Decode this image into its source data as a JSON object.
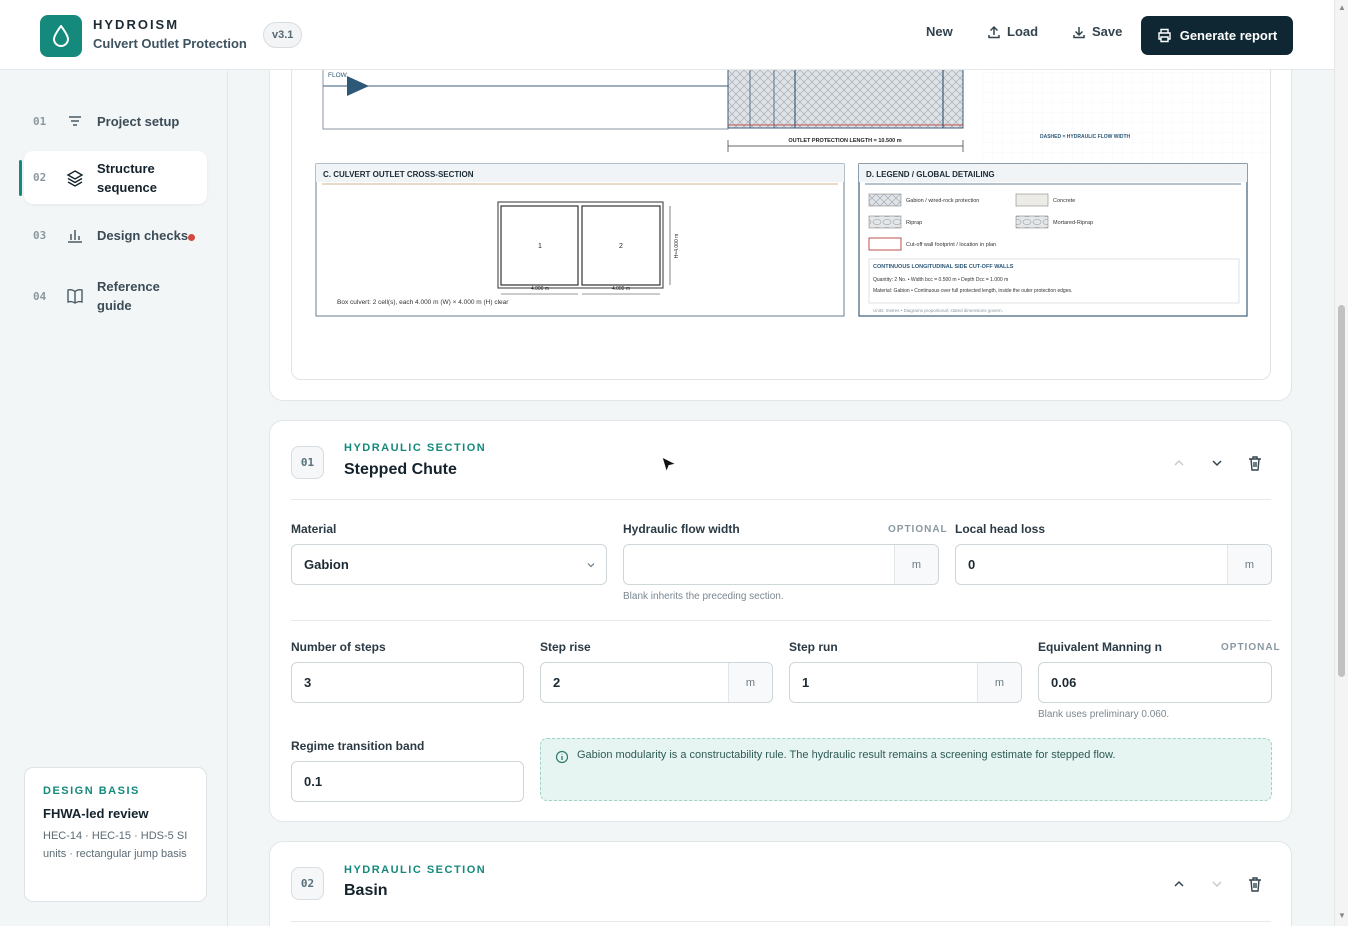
{
  "header": {
    "brand": "HYDROISM",
    "subtitle": "Culvert Outlet Protection",
    "version": "v3.1",
    "new_label": "New",
    "load_label": "Load",
    "save_label": "Save",
    "generate_label": "Generate report"
  },
  "sidebar": {
    "items": [
      {
        "num": "01",
        "label": "Project setup",
        "icon": "filter-icon"
      },
      {
        "num": "02",
        "label": "Structure sequence",
        "icon": "layers-icon"
      },
      {
        "num": "03",
        "label": "Design checks",
        "icon": "chart-icon"
      },
      {
        "num": "04",
        "label": "Reference guide",
        "icon": "book-icon"
      }
    ],
    "basis": {
      "kicker": "DESIGN BASIS",
      "title": "FHWA-led review",
      "desc": "HEC-14 · HEC-15 · HDS-5 SI units · rectangular jump basis"
    }
  },
  "drawing": {
    "flow_label": "FLOW",
    "length_label": "OUTLET PROTECTION LENGTH = 10.500 m",
    "dashed_note": "DASHED = HYDRAULIC FLOW WIDTH",
    "section_c": {
      "title": "C. CULVERT OUTLET CROSS-SECTION",
      "cell1": "1",
      "cell2": "2",
      "dim1": "4.000 m",
      "dim2": "4.000 m",
      "height": "H=4.000 m",
      "caption": "Box culvert: 2 cell(s), each 4.000 m (W) × 4.000 m (H) clear"
    },
    "section_d": {
      "title": "D. LEGEND / GLOBAL DETAILING",
      "legend": [
        "Gabion / wired-rock protection",
        "Concrete",
        "Riprap",
        "Mortared-Riprap",
        "Cut-off wall footprint / location in plan"
      ],
      "box_title": "CONTINUOUS LONGITUDINAL SIDE CUT-OFF WALLS",
      "box_line1": "Quantity: 2 No. • Width bcc = 0.500 m • Depth Dcc = 1.000 m",
      "box_line2": "Material: Gabion • Continuous over full protected length, inside the outer protection edges.",
      "units_note": "Units: metres • Diagrams proportional; stated dimensions govern."
    }
  },
  "section1": {
    "num": "01",
    "kicker": "HYDRAULIC SECTION",
    "title": "Stepped Chute",
    "material_label": "Material",
    "material_value": "Gabion",
    "flow_width_label": "Hydraulic flow width",
    "optional": "OPTIONAL",
    "flow_width_value": "",
    "flow_width_unit": "m",
    "flow_width_hint": "Blank inherits the preceding section.",
    "head_loss_label": "Local head loss",
    "head_loss_value": "0",
    "head_loss_unit": "m",
    "steps_label": "Number of steps",
    "steps_value": "3",
    "rise_label": "Step rise",
    "rise_value": "2",
    "rise_unit": "m",
    "run_label": "Step run",
    "run_value": "1",
    "run_unit": "m",
    "manning_label": "Equivalent Manning n",
    "manning_value": "0.06",
    "manning_hint": "Blank uses preliminary 0.060.",
    "regime_label": "Regime transition band",
    "regime_value": "0.1",
    "info": "Gabion modularity is a constructability rule. The hydraulic result remains a screening estimate for stepped flow."
  },
  "section2": {
    "num": "02",
    "kicker": "HYDRAULIC SECTION",
    "title": "Basin"
  },
  "colors": {
    "accent": "#14897c",
    "dark": "#0f2733",
    "alert": "#d34a3e"
  }
}
